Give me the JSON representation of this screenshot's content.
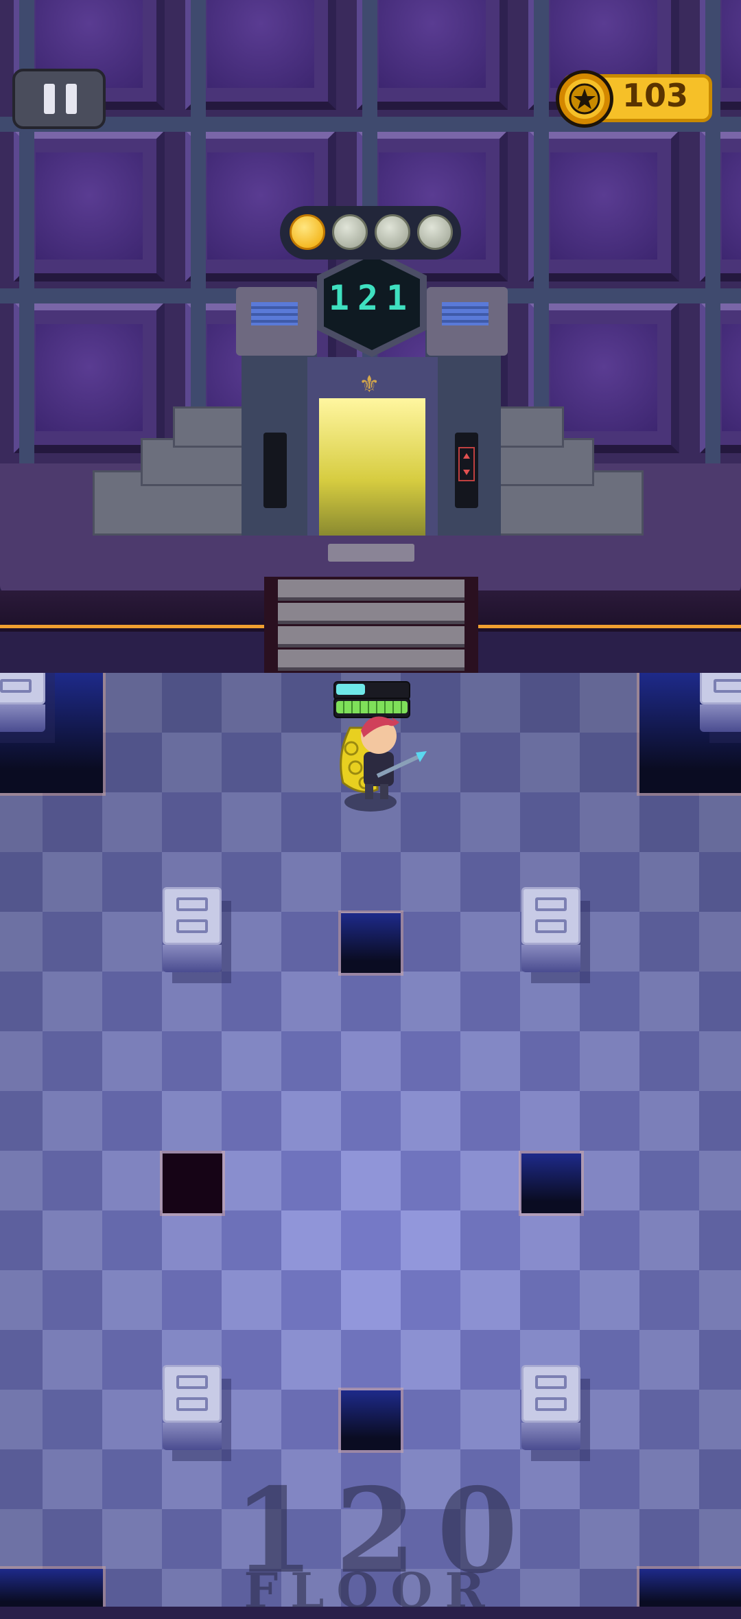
{
  "hud": {
    "pause_label": "Pause",
    "coins": "103",
    "coin_icon": "star-coin-icon"
  },
  "elevator": {
    "floor_display": "121",
    "progress_dots_total": 4,
    "progress_dots_filled": 1
  },
  "player": {
    "health_fraction": 0.4,
    "energy_fraction": 1.0
  },
  "floor_label": {
    "number": "120",
    "word": "FLOOR"
  },
  "colors": {
    "accent_gold": "#f6c028",
    "floor_display": "#3fe0c0",
    "health": "#6fe8e8",
    "energy": "#7fe05a"
  }
}
